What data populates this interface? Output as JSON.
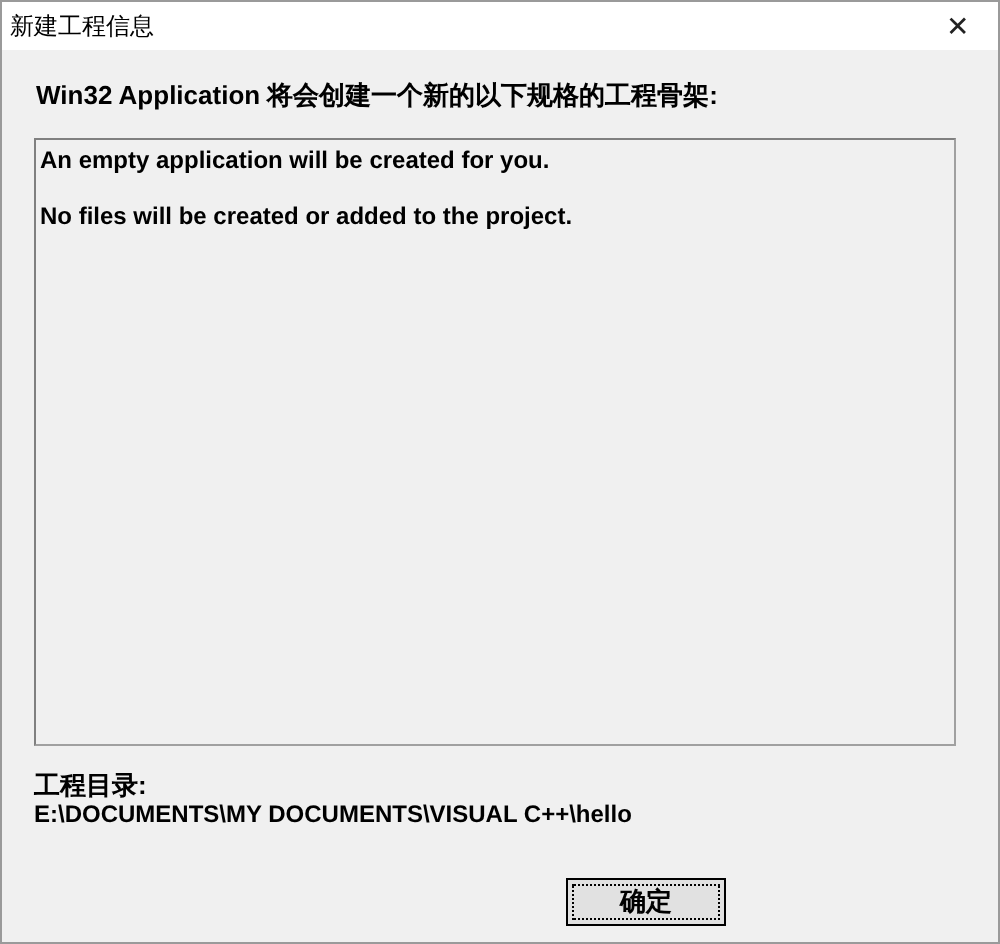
{
  "window": {
    "title": "新建工程信息",
    "close": "✕"
  },
  "heading": "Win32 Application 将会创建一个新的以下规格的工程骨架:",
  "info_lines": [
    "An empty application will be created for you.",
    "No files will be created or added to the project."
  ],
  "directory": {
    "label": "工程目录:",
    "path": "E:\\DOCUMENTS\\MY DOCUMENTS\\VISUAL C++\\hello"
  },
  "buttons": [
    {
      "label": "确定",
      "default": true
    }
  ]
}
